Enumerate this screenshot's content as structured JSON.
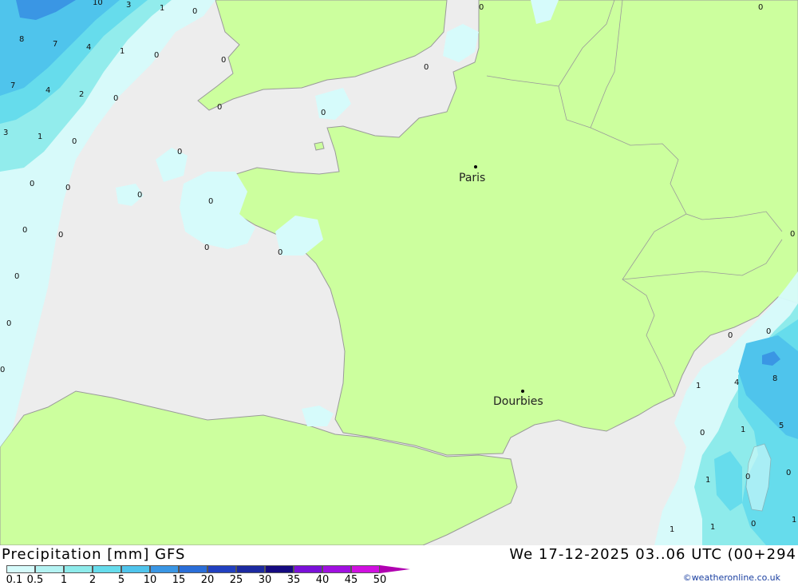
{
  "title": "Precipitation [mm] GFS",
  "datetime": "We 17-12-2025 03..06 UTC (00+294",
  "credit": "©weatheronline.co.uk",
  "colors": {
    "sea": "#ededed",
    "land": "#ccff9e",
    "border": "#9a9a9a"
  },
  "legend": {
    "labels": [
      "0.1",
      "0.5",
      "1",
      "2",
      "5",
      "10",
      "15",
      "20",
      "25",
      "30",
      "35",
      "40",
      "45",
      "50"
    ],
    "colors": [
      "#d6fbfb",
      "#b4f3f3",
      "#8eebeb",
      "#66dcec",
      "#4fc4ec",
      "#3a96e4",
      "#2a6ed8",
      "#2140c0",
      "#1c2aa0",
      "#150a80",
      "#7a10d8",
      "#a010e0",
      "#d010e0",
      "#c000c0"
    ],
    "arrow_color": "#b000b0"
  },
  "cities": [
    {
      "name": "Paris"
    },
    {
      "name": "Dourbies"
    }
  ],
  "precip_labels": [
    "10",
    "3",
    "1",
    "0",
    "8",
    "7",
    "4",
    "1",
    "0",
    "0",
    "7",
    "4",
    "2",
    "0",
    "0",
    "3",
    "1",
    "0",
    "0",
    "0",
    "0",
    "0",
    "0",
    "0",
    "0",
    "0",
    "0",
    "0",
    "0",
    "0",
    "0",
    "0",
    "0",
    "0",
    "0",
    "1",
    "4",
    "8",
    "1",
    "0",
    "5",
    "0",
    "1",
    "0",
    "1",
    "0",
    "1",
    "1",
    "0",
    "0"
  ]
}
